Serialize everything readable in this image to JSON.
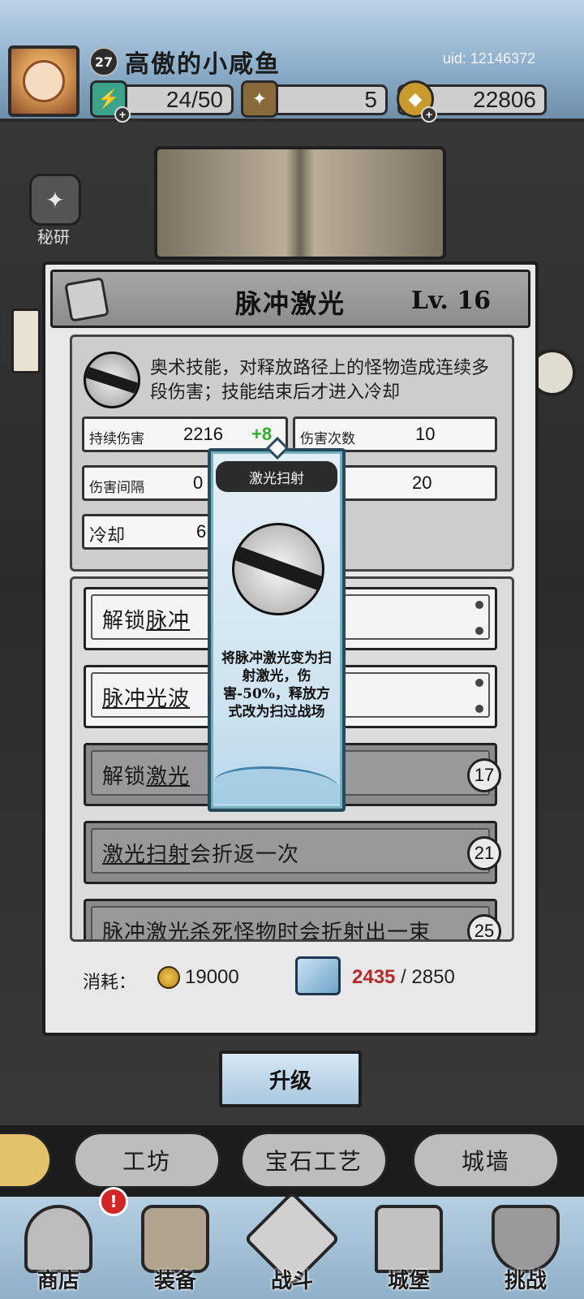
{
  "player": {
    "level": "27",
    "name": "高傲的小咸鱼",
    "uid": "uid: 12146372"
  },
  "resources": {
    "energy": "24/50",
    "tickets": "5",
    "gold": "22806"
  },
  "side": {
    "secret_label": "秘研"
  },
  "skill": {
    "name": "脉冲激光",
    "level_text": "Lv.  16",
    "description": "奥术技能，对释放路径上的怪物造成连续多段伤害；技能结束后才进入冷却",
    "stats": {
      "sustain_label": "持续伤害",
      "sustain_value": "2216",
      "sustain_bonus": "+8",
      "hits_label": "伤害次数",
      "hits_value": "10",
      "interval_label": "伤害间隔",
      "interval_value": "0",
      "fourth_value": "20",
      "cooldown_label": "冷却",
      "cooldown_value": "6"
    }
  },
  "upgrades": [
    {
      "prefix": "解锁",
      "underlined": "脉冲",
      "suffix": "",
      "required": "",
      "locked": false
    },
    {
      "prefix": "",
      "underlined": "脉冲光波",
      "suffix": "",
      "required": "",
      "locked": false
    },
    {
      "prefix": "解锁",
      "underlined": "激光",
      "suffix": "",
      "required": "17",
      "locked": true
    },
    {
      "prefix": "",
      "underlined": "激光扫射",
      "suffix": "会折返一次",
      "required": "21",
      "locked": true
    },
    {
      "prefix": "",
      "underlined": "",
      "suffix": "脉冲激光杀死怪物时会折射出一束",
      "required": "25",
      "locked": true
    }
  ],
  "cost": {
    "label": "消耗：",
    "gold": "19000",
    "shard_current": "2435",
    "shard_max": " / 2850"
  },
  "tooltip": {
    "title": "激光扫射",
    "description": "将脉冲激光变为扫射激光，伤害-50%，释放方式改为扫过战场"
  },
  "upgrade_button": "升级",
  "subtabs": [
    "工坊",
    "宝石工艺",
    "城墙"
  ],
  "nav": [
    {
      "label": "商店",
      "icon": "shop-icon"
    },
    {
      "label": "装备",
      "icon": "backpack-icon"
    },
    {
      "label": "战斗",
      "icon": "crossed-swords-icon"
    },
    {
      "label": "城堡",
      "icon": "castle-icon"
    },
    {
      "label": "挑战",
      "icon": "shield-icon"
    }
  ],
  "alert_badge": "!",
  "colors": {
    "bonus_green": "#2dae2d",
    "shard_red": "#b5292b",
    "tooltip_border": "#264b5d"
  }
}
